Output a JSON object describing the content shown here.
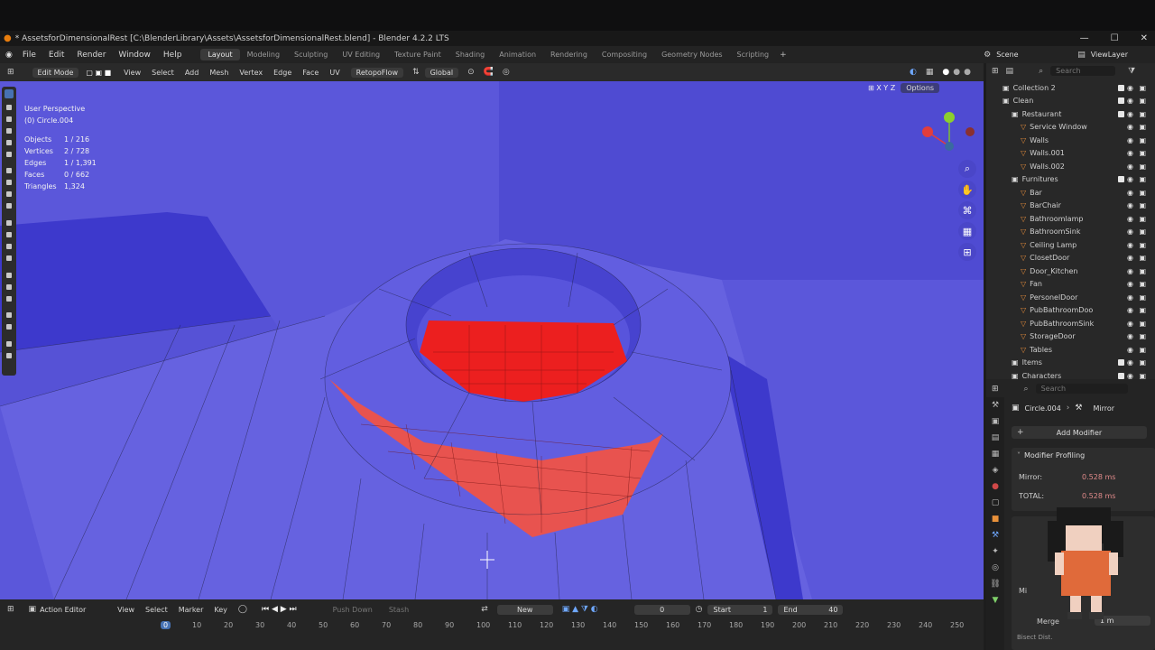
{
  "window": {
    "title": "* AssetsforDimensionalRest [C:\\BlenderLibrary\\Assets\\AssetsforDimensionalRest.blend] - Blender 4.2.2 LTS"
  },
  "menu": [
    "File",
    "Edit",
    "Render",
    "Window",
    "Help"
  ],
  "workspaces": [
    "Layout",
    "Modeling",
    "Sculpting",
    "UV Editing",
    "Texture Paint",
    "Shading",
    "Animation",
    "Rendering",
    "Compositing",
    "Geometry Nodes",
    "Scripting"
  ],
  "active_workspace": "Layout",
  "scene": {
    "label": "Scene",
    "view_layer": "ViewLayer"
  },
  "viewport_header": {
    "mode": "Edit Mode",
    "menus": [
      "View",
      "Select",
      "Add",
      "Mesh",
      "Vertex",
      "Edge",
      "Face",
      "UV"
    ],
    "addon": "RetopoFlow",
    "orientation": "Global",
    "options": "Options"
  },
  "viewport_overlay": {
    "view": "User Perspective",
    "object": "(0) Circle.004",
    "stats": [
      {
        "label": "Objects",
        "value": "1 / 216"
      },
      {
        "label": "Vertices",
        "value": "2 / 728"
      },
      {
        "label": "Edges",
        "value": "1 / 1,391"
      },
      {
        "label": "Faces",
        "value": "0 / 662"
      },
      {
        "label": "Triangles",
        "value": "1,324"
      }
    ]
  },
  "outliner": {
    "search_placeholder": "Search",
    "rows": [
      {
        "label": "Collection 2",
        "indent": 1,
        "kind": "collection"
      },
      {
        "label": "Clean",
        "indent": 1,
        "kind": "collection"
      },
      {
        "label": "Restaurant",
        "indent": 2,
        "kind": "collection"
      },
      {
        "label": "Service Window",
        "indent": 3,
        "kind": "object"
      },
      {
        "label": "Walls",
        "indent": 3,
        "kind": "object"
      },
      {
        "label": "Walls.001",
        "indent": 3,
        "kind": "object"
      },
      {
        "label": "Walls.002",
        "indent": 3,
        "kind": "object"
      },
      {
        "label": "Furnitures",
        "indent": 2,
        "kind": "collection"
      },
      {
        "label": "Bar",
        "indent": 3,
        "kind": "object"
      },
      {
        "label": "BarChair",
        "indent": 3,
        "kind": "object"
      },
      {
        "label": "Bathroomlamp",
        "indent": 3,
        "kind": "object"
      },
      {
        "label": "BathroomSink",
        "indent": 3,
        "kind": "object"
      },
      {
        "label": "Ceiling Lamp",
        "indent": 3,
        "kind": "object"
      },
      {
        "label": "ClosetDoor",
        "indent": 3,
        "kind": "object"
      },
      {
        "label": "Door_Kitchen",
        "indent": 3,
        "kind": "object"
      },
      {
        "label": "Fan",
        "indent": 3,
        "kind": "object"
      },
      {
        "label": "PersonelDoor",
        "indent": 3,
        "kind": "object"
      },
      {
        "label": "PubBathroomDoo",
        "indent": 3,
        "kind": "object"
      },
      {
        "label": "PubBathroomSink",
        "indent": 3,
        "kind": "object"
      },
      {
        "label": "StorageDoor",
        "indent": 3,
        "kind": "object"
      },
      {
        "label": "Tables",
        "indent": 3,
        "kind": "object"
      },
      {
        "label": "Items",
        "indent": 2,
        "kind": "collection"
      },
      {
        "label": "Characters",
        "indent": 2,
        "kind": "collection"
      }
    ]
  },
  "properties": {
    "search_placeholder": "Search",
    "object": "Circle.004",
    "modifier": "Mirror",
    "add_modifier": "Add Modifier",
    "profiling_title": "Modifier Profiling",
    "profiling": [
      {
        "label": "Mirror:",
        "value": "0.528 ms"
      },
      {
        "label": "TOTAL:",
        "value": "0.528 ms"
      }
    ],
    "merge_label": "Merge",
    "merge_value": "1 m",
    "partial_labels": [
      "Mi",
      "Bisect Dist."
    ]
  },
  "timeline": {
    "editor": "Action Editor",
    "menus": [
      "View",
      "Select",
      "Marker",
      "Key"
    ],
    "push_down": "Push Down",
    "stash": "Stash",
    "new": "New",
    "current_frame": "0",
    "start_label": "Start",
    "start": "1",
    "end_label": "End",
    "end": "40",
    "ticks": [
      "0",
      "10",
      "20",
      "30",
      "40",
      "50",
      "60",
      "70",
      "80",
      "90",
      "100",
      "110",
      "120",
      "130",
      "140",
      "150",
      "160",
      "170",
      "180",
      "190",
      "200",
      "210",
      "220",
      "230",
      "240",
      "250"
    ]
  },
  "colors": {
    "viewport": "#5a55d8",
    "selected_faces": "#e8413f",
    "accent": "#4772b3"
  }
}
